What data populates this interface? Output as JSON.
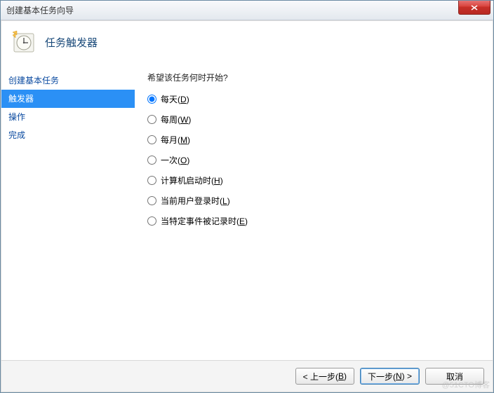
{
  "window": {
    "title": "创建基本任务向导"
  },
  "page": {
    "heading": "任务触发器"
  },
  "sidebar": {
    "items": [
      {
        "label": "创建基本任务",
        "selected": false
      },
      {
        "label": "触发器",
        "selected": true
      },
      {
        "label": "操作",
        "selected": false
      },
      {
        "label": "完成",
        "selected": false
      }
    ]
  },
  "main": {
    "question": "希望该任务何时开始?",
    "options": [
      {
        "label": "每天",
        "accel": "D",
        "checked": true
      },
      {
        "label": "每周",
        "accel": "W",
        "checked": false
      },
      {
        "label": "每月",
        "accel": "M",
        "checked": false
      },
      {
        "label": "一次",
        "accel": "O",
        "checked": false
      },
      {
        "label": "计算机启动时",
        "accel": "H",
        "checked": false
      },
      {
        "label": "当前用户登录时",
        "accel": "L",
        "checked": false
      },
      {
        "label": "当特定事件被记录时",
        "accel": "E",
        "checked": false
      }
    ]
  },
  "footer": {
    "back_prefix": "< 上一步(",
    "back_accel": "B",
    "back_suffix": ")",
    "next_prefix": "下一步(",
    "next_accel": "N",
    "next_suffix": ") >",
    "cancel": "取消"
  },
  "watermark": "@51CTO博客"
}
